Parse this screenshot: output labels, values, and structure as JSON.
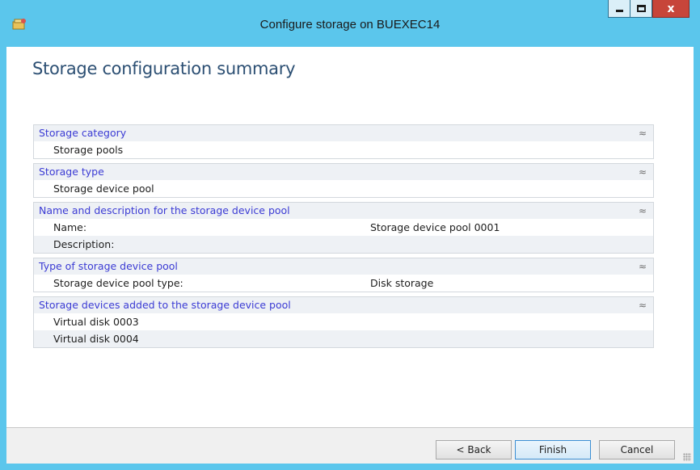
{
  "window": {
    "title": "Configure storage on BUEXEC14",
    "close_glyph": "x",
    "icons": {
      "app": "storage-wizard-icon",
      "minimize": "minimize-icon",
      "maximize": "maximize-icon",
      "close": "close-icon"
    },
    "colors": {
      "frame": "#5bc6ec",
      "close": "#c7453a",
      "title_text": "#2c4f73",
      "section_header_text": "#3b3bd4"
    }
  },
  "page": {
    "title": "Storage configuration summary"
  },
  "sections": [
    {
      "header": "Storage category",
      "rows": [
        {
          "label": "Storage pools",
          "value": ""
        }
      ]
    },
    {
      "header": "Storage type",
      "rows": [
        {
          "label": "Storage device pool",
          "value": ""
        }
      ]
    },
    {
      "header": "Name and description for the storage device pool",
      "rows": [
        {
          "label": "Name:",
          "value": "Storage device pool 0001"
        },
        {
          "label": "Description:",
          "value": ""
        }
      ]
    },
    {
      "header": "Type of storage device pool",
      "rows": [
        {
          "label": "Storage device pool type:",
          "value": "Disk storage"
        }
      ]
    },
    {
      "header": "Storage devices added to the storage device pool",
      "rows": [
        {
          "label": "Virtual disk 0003",
          "value": ""
        },
        {
          "label": "Virtual disk 0004",
          "value": ""
        }
      ]
    }
  ],
  "collapse_glyph": "≈",
  "footer": {
    "back_label": "< Back",
    "finish_label": "Finish",
    "cancel_label": "Cancel"
  }
}
